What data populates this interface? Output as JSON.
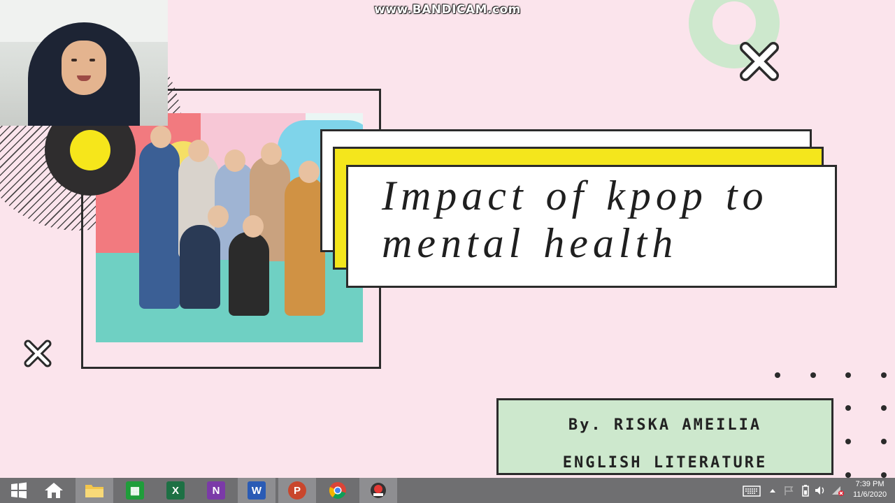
{
  "watermark": "www.BANDICAM.com",
  "slide": {
    "title_line1": "Impact of kpop to",
    "title_line2": "mental health",
    "author": "By. RISKA AMEILIA",
    "department": "ENGLISH LITERATURE"
  },
  "colors": {
    "background": "#fbe4ec",
    "accent_yellow": "#f4e61c",
    "mint": "#cde8cd",
    "dark": "#2b2b2b",
    "taskbar": "#6f6f71"
  },
  "taskbar": {
    "apps": [
      {
        "name": "start",
        "icon": "windows-icon"
      },
      {
        "name": "home",
        "icon": "home-icon"
      },
      {
        "name": "file-explorer",
        "icon": "folder-icon"
      },
      {
        "name": "store",
        "icon": "store-icon"
      },
      {
        "name": "excel",
        "icon": "excel-icon",
        "letter": "X"
      },
      {
        "name": "onenote",
        "icon": "onenote-icon",
        "letter": "N"
      },
      {
        "name": "word",
        "icon": "word-icon",
        "letter": "W"
      },
      {
        "name": "powerpoint",
        "icon": "powerpoint-icon",
        "letter": "P"
      },
      {
        "name": "chrome",
        "icon": "chrome-icon"
      },
      {
        "name": "bandicam",
        "icon": "bandicam-icon"
      }
    ],
    "clock_time": "7:39 PM",
    "clock_date": "11/6/2020"
  }
}
